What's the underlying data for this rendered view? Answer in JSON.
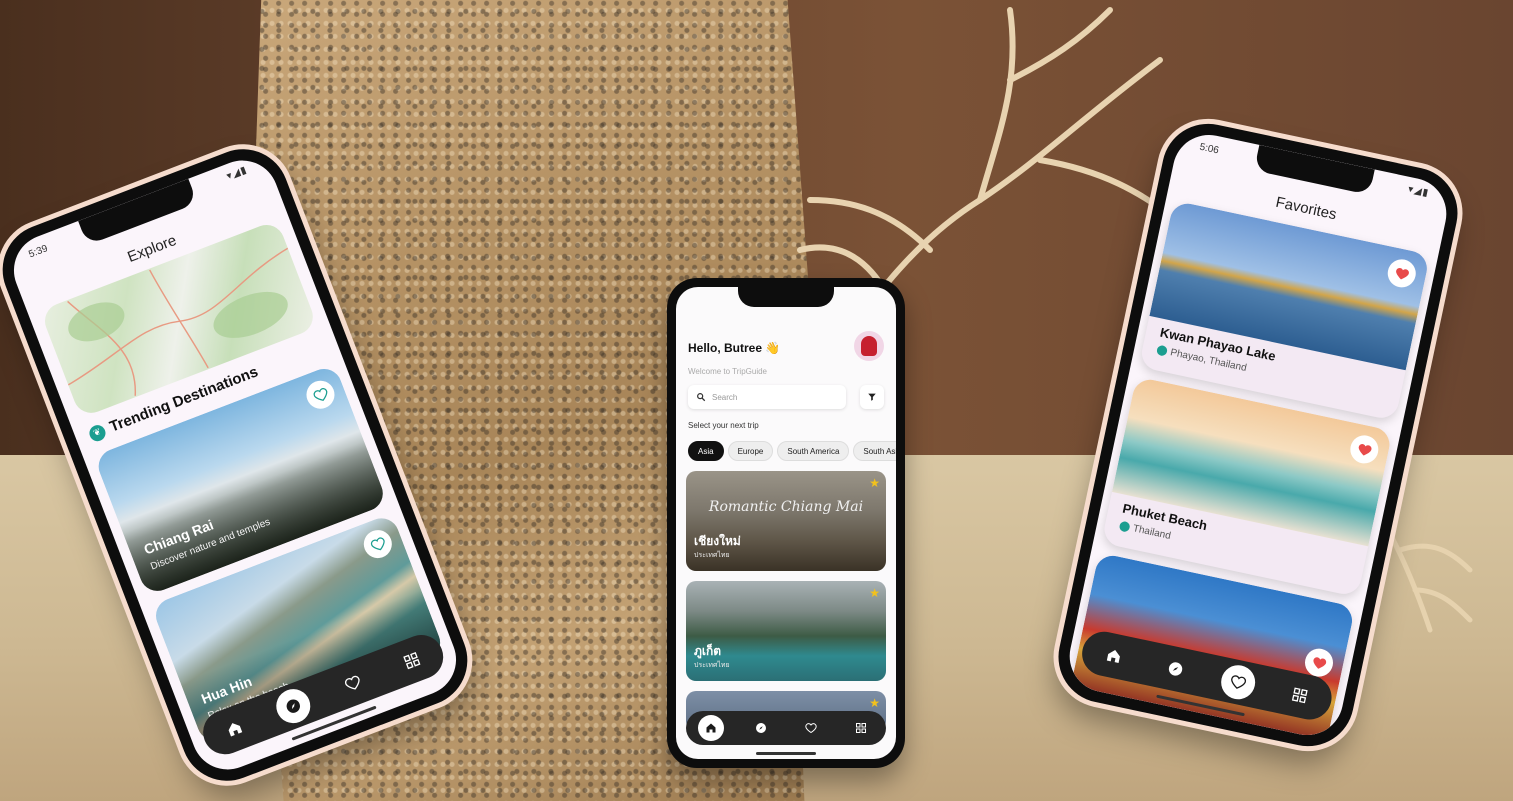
{
  "left_phone": {
    "status_time": "5:39",
    "title": "Explore",
    "section_title": "Trending Destinations",
    "cards": [
      {
        "title": "Chiang Rai",
        "subtitle": "Discover nature and temples"
      },
      {
        "title": "Hua Hin",
        "subtitle": "Relax on the beach"
      }
    ],
    "nav": [
      "home-icon",
      "compass-icon",
      "heart-icon",
      "grid-icon"
    ],
    "active_nav": "compass-icon"
  },
  "center_phone": {
    "greeting": "Hello, Butree 👋",
    "welcome": "Welcome to TripGuide",
    "search_placeholder": "Search",
    "section_label": "Select your next trip",
    "chips": [
      "Asia",
      "Europe",
      "South America",
      "South Asia"
    ],
    "active_chip": "Asia",
    "trips": [
      {
        "title": "เชียงใหม่",
        "subtitle": "ประเทศไทย",
        "overlay": "Romantic Chiang Mai"
      },
      {
        "title": "ภูเก็ต",
        "subtitle": "ประเทศไทย"
      },
      {
        "title": ""
      }
    ],
    "nav": [
      "home-icon",
      "compass-icon",
      "heart-icon",
      "grid-icon"
    ],
    "active_nav": "home-icon"
  },
  "right_phone": {
    "status_time": "5:06",
    "title": "Favorites",
    "cards": [
      {
        "title": "Kwan Phayao Lake",
        "location": "Phayao, Thailand"
      },
      {
        "title": "Phuket Beach",
        "location": "Thailand"
      },
      {
        "title": "",
        "location": ""
      }
    ],
    "nav": [
      "home-icon",
      "compass-icon",
      "heart-icon",
      "grid-icon"
    ],
    "active_nav": "heart-icon"
  },
  "colors": {
    "heart_red": "#e84a4a",
    "teal": "#1b9e90",
    "nav_bg": "#262626",
    "star": "#f3c21c"
  }
}
